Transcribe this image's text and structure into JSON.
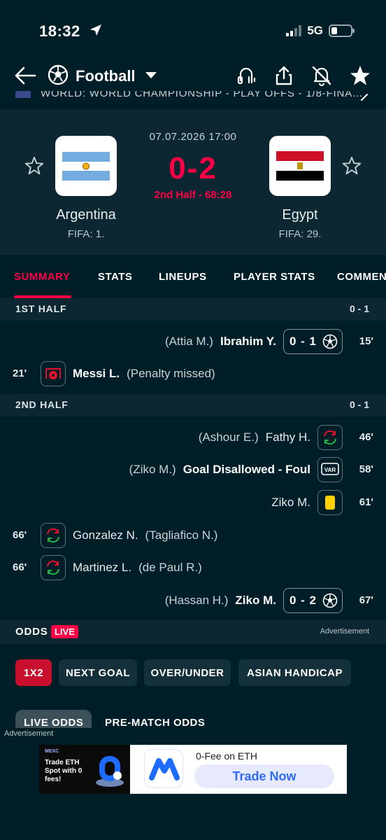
{
  "status_bar": {
    "time": "18:32",
    "network": "5G"
  },
  "nav": {
    "title": "Football"
  },
  "competition": {
    "text": "WORLD: WORLD CHAMPIONSHIP - PLAY OFFS - 1/8-FINA..."
  },
  "match": {
    "datetime": "07.07.2026 17:00",
    "score": "0-2",
    "status": "2nd Half - 68:28",
    "home": {
      "name": "Argentina",
      "rank": "FIFA: 1."
    },
    "away": {
      "name": "Egypt",
      "rank": "FIFA: 29."
    }
  },
  "tabs": [
    "SUMMARY",
    "STATS",
    "LINEUPS",
    "PLAYER STATS",
    "COMMENTARY"
  ],
  "first_half": {
    "title": "1ST HALF",
    "score": "0 - 1",
    "events": [
      {
        "minute": "15'",
        "assist": "(Attia M.)",
        "player": "Ibrahim Y.",
        "score": "0 - 1"
      },
      {
        "minute": "21'",
        "player": "Messi L.",
        "note": "(Penalty missed)"
      }
    ]
  },
  "second_half": {
    "title": "2ND HALF",
    "score": "0 - 1",
    "events": [
      {
        "minute": "46'",
        "assist": "(Ashour E.)",
        "player": "Fathy H."
      },
      {
        "minute": "58'",
        "assist": "(Ziko M.)",
        "player": "Goal Disallowed - Foul",
        "icon_text": "VAR"
      },
      {
        "minute": "61'",
        "player": "Ziko M."
      },
      {
        "minute": "66'",
        "player": "Gonzalez N.",
        "assist": "(Tagliafico N.)"
      },
      {
        "minute": "66'",
        "player": "Martinez L.",
        "assist": "(de Paul R.)"
      },
      {
        "minute": "67'",
        "assist": "(Hassan H.)",
        "player": "Ziko M.",
        "score": "0 - 2"
      }
    ]
  },
  "odds": {
    "title": "ODDS",
    "live_badge": "LIVE",
    "advertisement": "Advertisement",
    "markets": [
      "1X2",
      "NEXT GOAL",
      "OVER/UNDER",
      "ASIAN HANDICAP"
    ],
    "sub_tabs": [
      "LIVE ODDS",
      "PRE-MATCH ODDS"
    ]
  },
  "ad": {
    "label": "Advertisement",
    "brand": "MEXC",
    "promo": "Trade ETH Spot with 0 fees!",
    "headline": "0-Fee on ETH",
    "cta": "Trade Now"
  },
  "colors": {
    "background": "#001e28",
    "panel": "#0c2731",
    "accent": "#ff0046",
    "yellow_card": "#ffd200",
    "sub_in": "#21b24b",
    "sub_out": "#e8112d"
  }
}
